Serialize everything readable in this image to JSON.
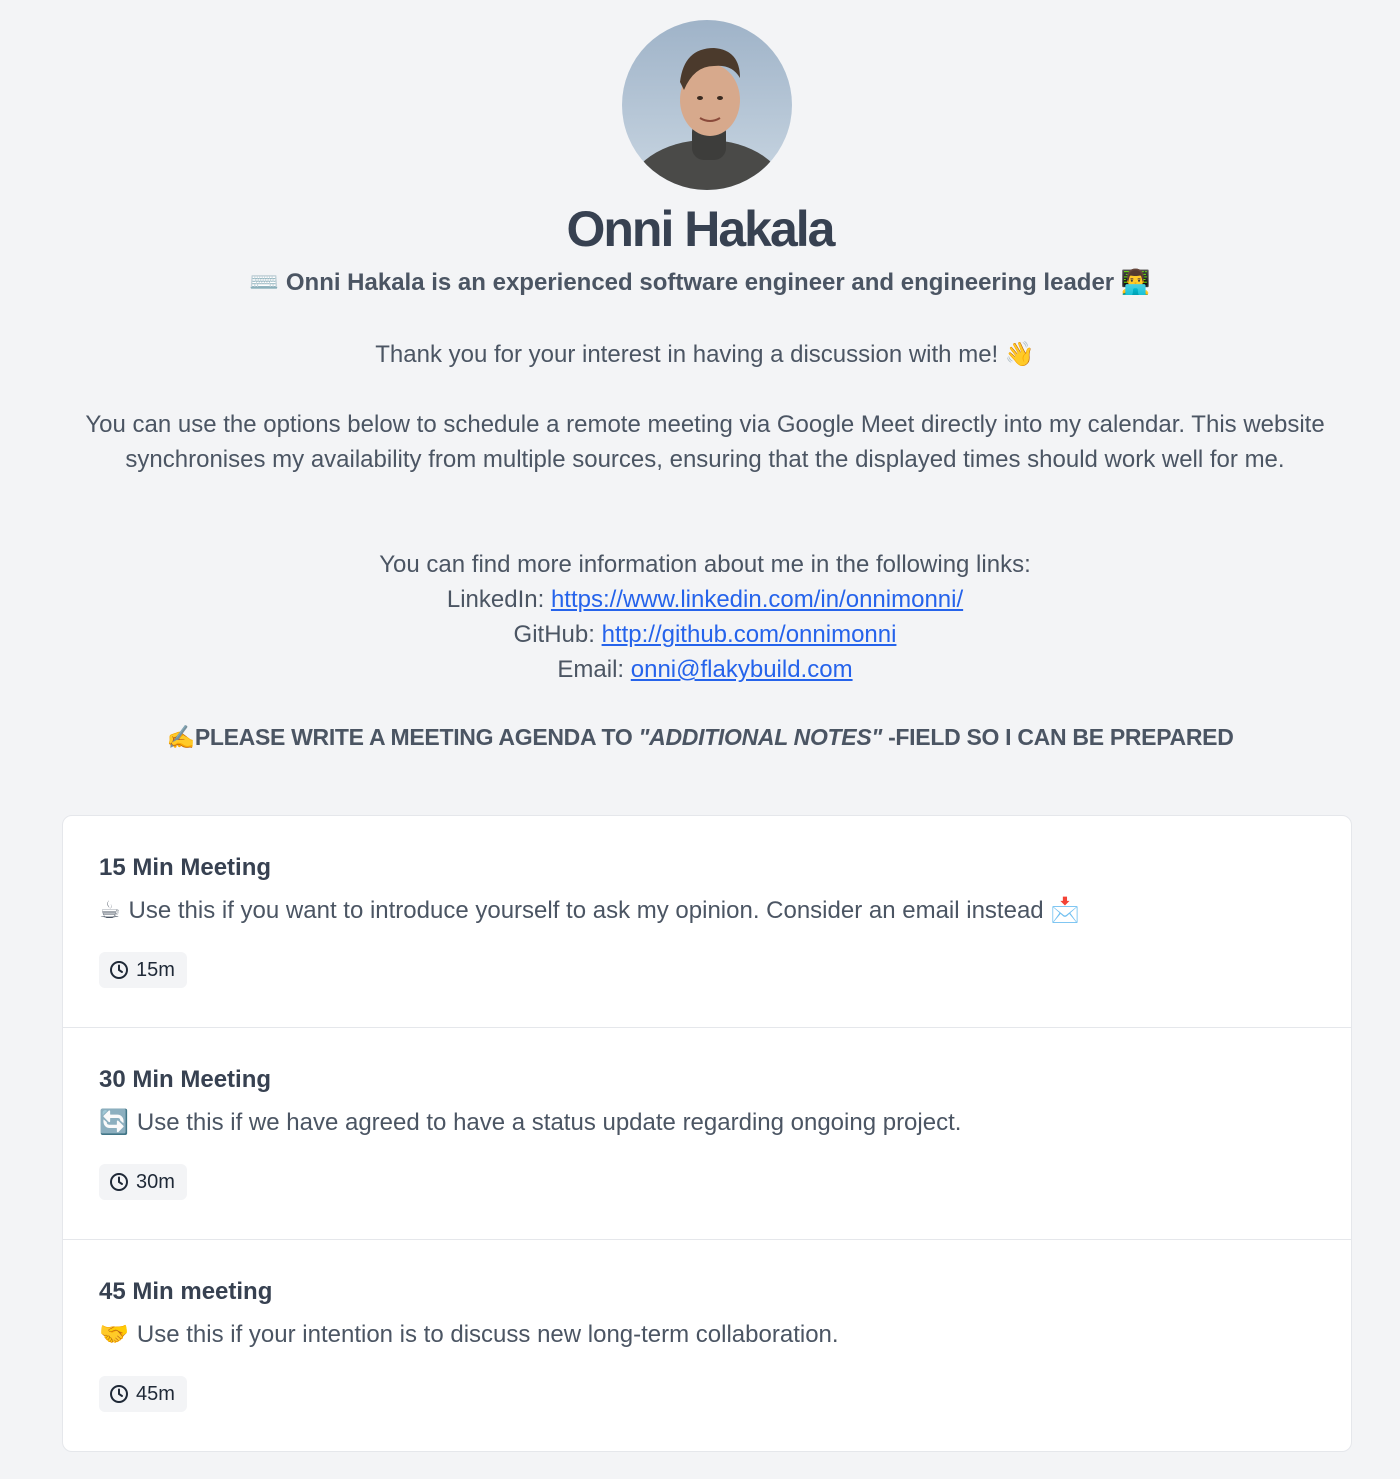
{
  "profile": {
    "name": "Onni Hakala",
    "tagline_prefix_emoji": "⌨️",
    "tagline": "Onni Hakala is an experienced software engineer and engineering leader",
    "tagline_suffix_emoji": "👨‍💻"
  },
  "intro": {
    "thanks": "Thank you for your interest in having a discussion with me! 👋",
    "options_text": "You can use the options below to schedule a remote meeting via Google Meet directly into my calendar. This website synchronises my availability from multiple sources, ensuring that the displayed times should work well for me.",
    "links_intro": "You can find more information about me in the following links:",
    "linkedin_label": "LinkedIn:",
    "linkedin_url": "https://www.linkedin.com/in/onnimonni/",
    "github_label": "GitHub:",
    "github_url": "http://github.com/onnimonni",
    "email_label": "Email:",
    "email": "onni@flakybuild.com"
  },
  "agenda_notice": {
    "emoji": "✍️",
    "before": "PLEASE WRITE A MEETING AGENDA TO ",
    "emphasis": "\"ADDITIONAL NOTES\"",
    "after": " -FIELD SO I CAN BE PREPARED"
  },
  "events": [
    {
      "title": "15 Min Meeting",
      "emoji": "☕",
      "description": "Use this if you want to introduce yourself to ask my opinion. Consider an email instead",
      "suffix_emoji": "📩",
      "duration": "15m"
    },
    {
      "title": "30 Min Meeting",
      "emoji": "🔄",
      "description": "Use this if we have agreed to have a status update regarding ongoing project.",
      "suffix_emoji": "",
      "duration": "30m"
    },
    {
      "title": "45 Min meeting",
      "emoji": "🤝",
      "description": "Use this if your intention is to discuss new long-term collaboration.",
      "suffix_emoji": "",
      "duration": "45m"
    }
  ],
  "icons": {
    "duration": "clock-icon",
    "avatar": "profile-photo"
  },
  "colors": {
    "background": "#f3f4f6",
    "link": "#2563eb",
    "heading": "#374151",
    "text": "#4b5563"
  }
}
